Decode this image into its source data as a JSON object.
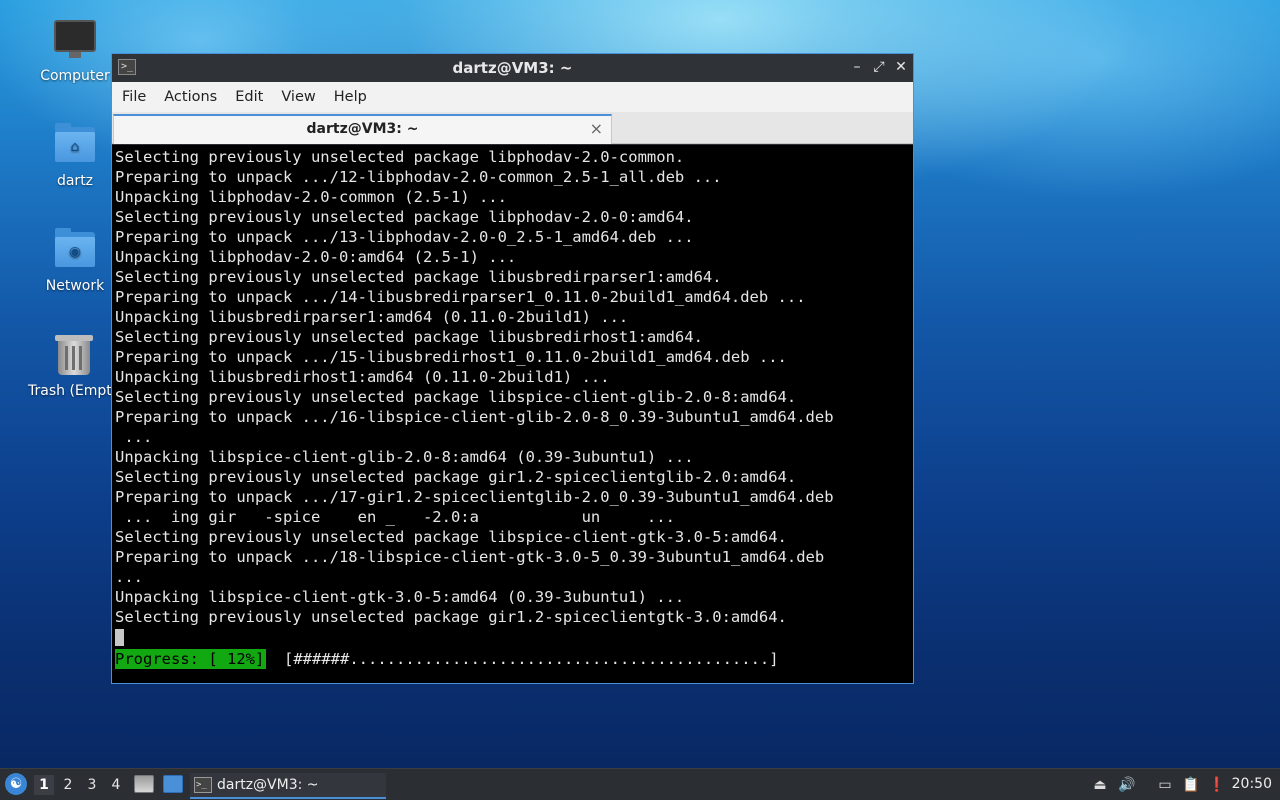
{
  "desktop": {
    "icons": [
      {
        "label": "Computer"
      },
      {
        "label": "dartz"
      },
      {
        "label": "Network"
      },
      {
        "label": "Trash (Empt"
      }
    ]
  },
  "window": {
    "title": "dartz@VM3: ~",
    "menu": [
      "File",
      "Actions",
      "Edit",
      "View",
      "Help"
    ],
    "tab_label": "dartz@VM3: ~",
    "tab_close": "×",
    "terminal_lines": [
      "Selecting previously unselected package libphodav-2.0-common.",
      "Preparing to unpack .../12-libphodav-2.0-common_2.5-1_all.deb ...",
      "Unpacking libphodav-2.0-common (2.5-1) ...",
      "Selecting previously unselected package libphodav-2.0-0:amd64.",
      "Preparing to unpack .../13-libphodav-2.0-0_2.5-1_amd64.deb ...",
      "Unpacking libphodav-2.0-0:amd64 (2.5-1) ...",
      "Selecting previously unselected package libusbredirparser1:amd64.",
      "Preparing to unpack .../14-libusbredirparser1_0.11.0-2build1_amd64.deb ...",
      "Unpacking libusbredirparser1:amd64 (0.11.0-2build1) ...",
      "Selecting previously unselected package libusbredirhost1:amd64.",
      "Preparing to unpack .../15-libusbredirhost1_0.11.0-2build1_amd64.deb ...",
      "Unpacking libusbredirhost1:amd64 (0.11.0-2build1) ...",
      "Selecting previously unselected package libspice-client-glib-2.0-8:amd64.",
      "Preparing to unpack .../16-libspice-client-glib-2.0-8_0.39-3ubuntu1_amd64.deb",
      " ...",
      "Unpacking libspice-client-glib-2.0-8:amd64 (0.39-3ubuntu1) ...",
      "Selecting previously unselected package gir1.2-spiceclientglib-2.0:amd64.",
      "Preparing to unpack .../17-gir1.2-spiceclientglib-2.0_0.39-3ubuntu1_amd64.deb",
      " ...  ing gir   -spice    en _   -2.0:a           un     ...",
      "Selecting previously unselected package libspice-client-gtk-3.0-5:amd64.",
      "Preparing to unpack .../18-libspice-client-gtk-3.0-5_0.39-3ubuntu1_amd64.deb",
      "...",
      "Unpacking libspice-client-gtk-3.0-5:amd64 (0.39-3ubuntu1) ...",
      "Selecting previously unselected package gir1.2-spiceclientgtk-3.0:amd64."
    ],
    "progress": {
      "label": "Progress: [ 12%]",
      "bar": "[######.............................................]",
      "percent": 12
    }
  },
  "taskbar": {
    "workspaces": [
      "1",
      "2",
      "3",
      "4"
    ],
    "active_workspace": "1",
    "task_label": "dartz@VM3: ~",
    "clock": "20:50"
  }
}
